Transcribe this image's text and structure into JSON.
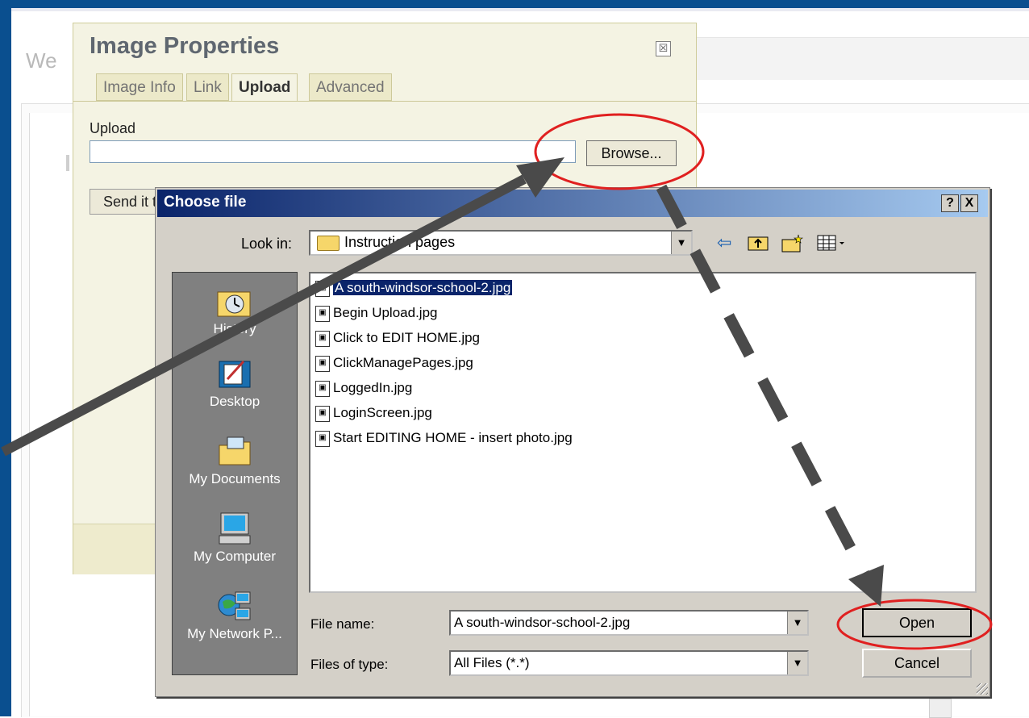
{
  "background": {
    "title": "We"
  },
  "image_dialog": {
    "title": "Image Properties",
    "close_glyph": "☒",
    "tabs": [
      "Image Info",
      "Link",
      "Upload",
      "Advanced"
    ],
    "active_tab": "Upload",
    "upload_label": "Upload",
    "upload_value": "",
    "browse_label": "Browse...",
    "send_label": "Send it to the Server"
  },
  "file_dialog": {
    "title": "Choose file",
    "help_label": "?",
    "close_label": "X",
    "look_in_label": "Look in:",
    "look_in_value": "Instruction pages",
    "places": [
      "History",
      "Desktop",
      "My Documents",
      "My Computer",
      "My Network P..."
    ],
    "files": [
      "A south-windsor-school-2.jpg",
      "Begin Upload.jpg",
      "Click to EDIT HOME.jpg",
      "ClickManagePages.jpg",
      "LoggedIn.jpg",
      "LoginScreen.jpg",
      "Start EDITING HOME - insert photo.jpg"
    ],
    "selected_file": "A south-windsor-school-2.jpg",
    "file_name_label": "File name:",
    "file_name_value": "A south-windsor-school-2.jpg",
    "file_type_label": "Files of type:",
    "file_type_value": "All Files (*.*)",
    "open_label": "Open",
    "cancel_label": "Cancel"
  },
  "annotations": {
    "highlight_color": "#e02020",
    "arrow_color": "#4a4a4a"
  }
}
